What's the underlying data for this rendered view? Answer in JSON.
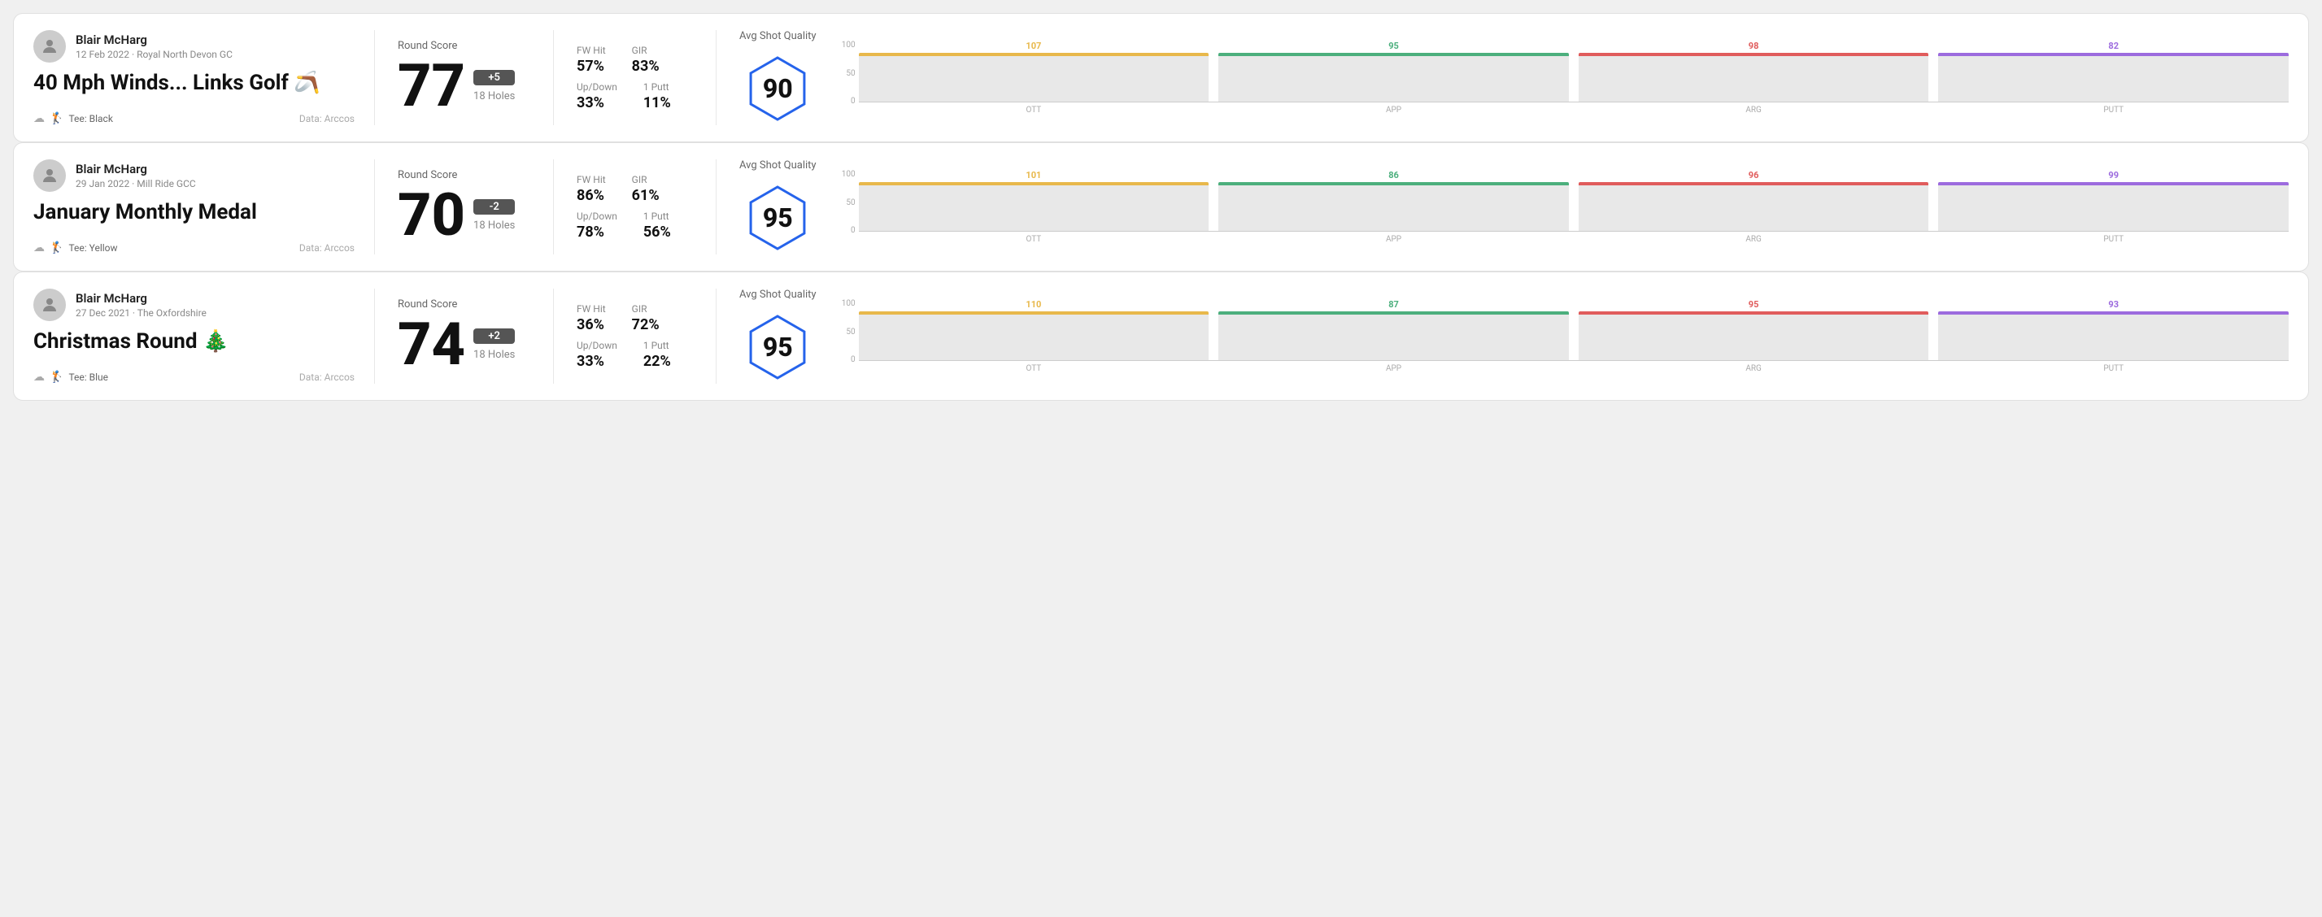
{
  "rounds": [
    {
      "id": "round-1",
      "user": {
        "name": "Blair McHarg",
        "meta": "12 Feb 2022 · Royal North Devon GC"
      },
      "title": "40 Mph Winds... Links Golf 🪃",
      "tee": "Black",
      "data_source": "Data: Arccos",
      "score": {
        "label": "Round Score",
        "number": "77",
        "badge": "+5",
        "badge_type": "plus",
        "holes": "18 Holes"
      },
      "stats": {
        "fw_hit_label": "FW Hit",
        "fw_hit_value": "57%",
        "gir_label": "GIR",
        "gir_value": "83%",
        "updown_label": "Up/Down",
        "updown_value": "33%",
        "oneputt_label": "1 Putt",
        "oneputt_value": "11%"
      },
      "quality": {
        "label": "Avg Shot Quality",
        "score": "90",
        "chart": {
          "bars": [
            {
              "label": "OTT",
              "value": 107,
              "color": "#e8b84b"
            },
            {
              "label": "APP",
              "value": 95,
              "color": "#4caf7d"
            },
            {
              "label": "ARG",
              "value": 98,
              "color": "#e05c5c"
            },
            {
              "label": "PUTT",
              "value": 82,
              "color": "#9c6bde"
            }
          ],
          "y_max": 100
        }
      }
    },
    {
      "id": "round-2",
      "user": {
        "name": "Blair McHarg",
        "meta": "29 Jan 2022 · Mill Ride GCC"
      },
      "title": "January Monthly Medal",
      "tee": "Yellow",
      "data_source": "Data: Arccos",
      "score": {
        "label": "Round Score",
        "number": "70",
        "badge": "-2",
        "badge_type": "minus",
        "holes": "18 Holes"
      },
      "stats": {
        "fw_hit_label": "FW Hit",
        "fw_hit_value": "86%",
        "gir_label": "GIR",
        "gir_value": "61%",
        "updown_label": "Up/Down",
        "updown_value": "78%",
        "oneputt_label": "1 Putt",
        "oneputt_value": "56%"
      },
      "quality": {
        "label": "Avg Shot Quality",
        "score": "95",
        "chart": {
          "bars": [
            {
              "label": "OTT",
              "value": 101,
              "color": "#e8b84b"
            },
            {
              "label": "APP",
              "value": 86,
              "color": "#4caf7d"
            },
            {
              "label": "ARG",
              "value": 96,
              "color": "#e05c5c"
            },
            {
              "label": "PUTT",
              "value": 99,
              "color": "#9c6bde"
            }
          ],
          "y_max": 100
        }
      }
    },
    {
      "id": "round-3",
      "user": {
        "name": "Blair McHarg",
        "meta": "27 Dec 2021 · The Oxfordshire"
      },
      "title": "Christmas Round 🎄",
      "tee": "Blue",
      "data_source": "Data: Arccos",
      "score": {
        "label": "Round Score",
        "number": "74",
        "badge": "+2",
        "badge_type": "plus",
        "holes": "18 Holes"
      },
      "stats": {
        "fw_hit_label": "FW Hit",
        "fw_hit_value": "36%",
        "gir_label": "GIR",
        "gir_value": "72%",
        "updown_label": "Up/Down",
        "updown_value": "33%",
        "oneputt_label": "1 Putt",
        "oneputt_value": "22%"
      },
      "quality": {
        "label": "Avg Shot Quality",
        "score": "95",
        "chart": {
          "bars": [
            {
              "label": "OTT",
              "value": 110,
              "color": "#e8b84b"
            },
            {
              "label": "APP",
              "value": 87,
              "color": "#4caf7d"
            },
            {
              "label": "ARG",
              "value": 95,
              "color": "#e05c5c"
            },
            {
              "label": "PUTT",
              "value": 93,
              "color": "#9c6bde"
            }
          ],
          "y_max": 100
        }
      }
    }
  ],
  "y_axis_labels": [
    "100",
    "50",
    "0"
  ]
}
